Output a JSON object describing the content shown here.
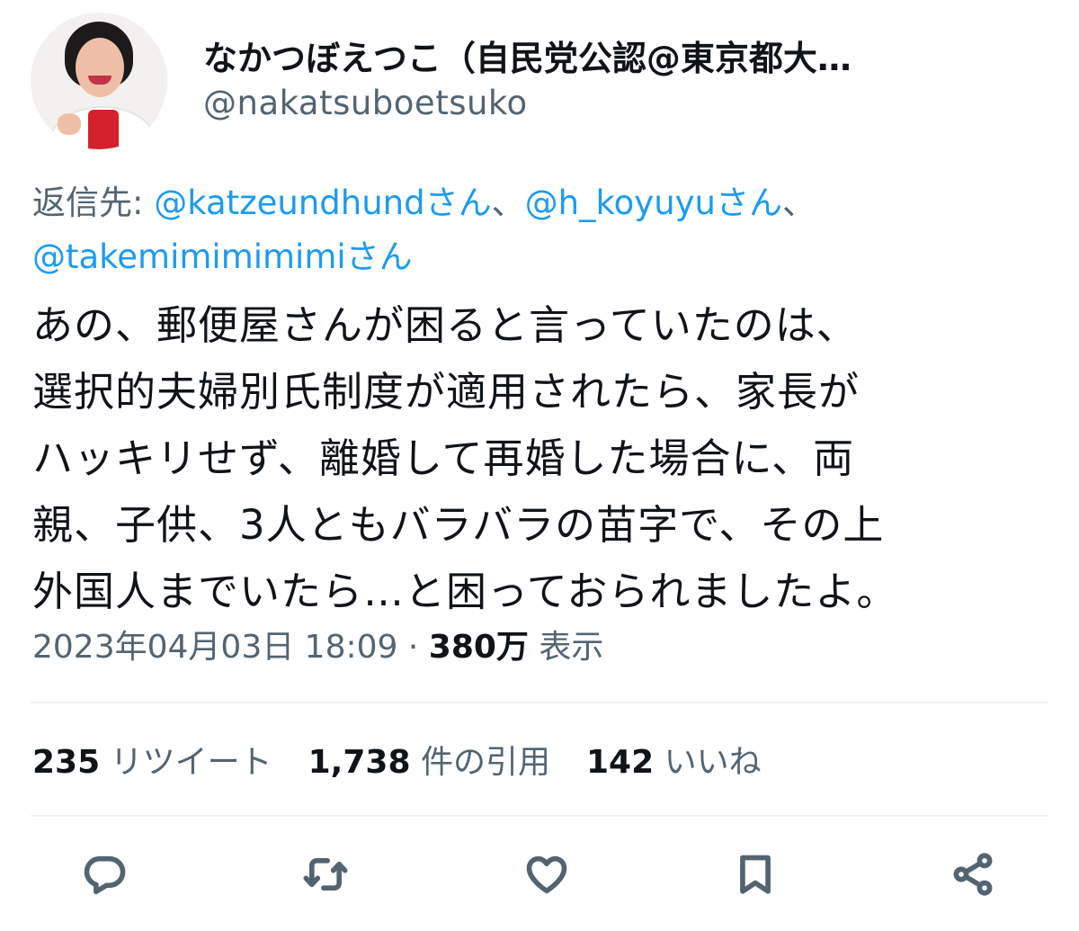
{
  "author": {
    "display_name": "なかつぼえつこ（自民党公認@東京都大…",
    "handle": "@nakatsuboetsuko"
  },
  "reply": {
    "prefix": "返信先: ",
    "mentions": [
      "@katzeundhundさん",
      "@h_koyuyuさん",
      "@takemimimimimiさん"
    ],
    "separator": "、"
  },
  "tweet": {
    "lines": [
      "あの、郵便屋さんが困ると言っていたのは、",
      "選択的夫婦別氏制度が適用されたら、家長が",
      "ハッキリせず、離婚して再婚した場合に、両",
      "親、子供、3人ともバラバラの苗字で、その上",
      "外国人までいたら…と困っておられましたよ。"
    ]
  },
  "meta": {
    "timestamp": "2023年04月03日 18:09",
    "dot": " · ",
    "views_count": "380万",
    "views_label": "表示"
  },
  "stats": {
    "retweets_count": "235",
    "retweets_label": "リツイート",
    "quotes_count": "1,738",
    "quotes_label": "件の引用",
    "likes_count": "142",
    "likes_label": "いいね"
  },
  "colors": {
    "text": "#0f1419",
    "secondary": "#536471",
    "link": "#1d9bf0",
    "divider": "#eff3f4"
  },
  "icons": [
    "reply-icon",
    "retweet-icon",
    "like-icon",
    "bookmark-icon",
    "share-icon"
  ]
}
